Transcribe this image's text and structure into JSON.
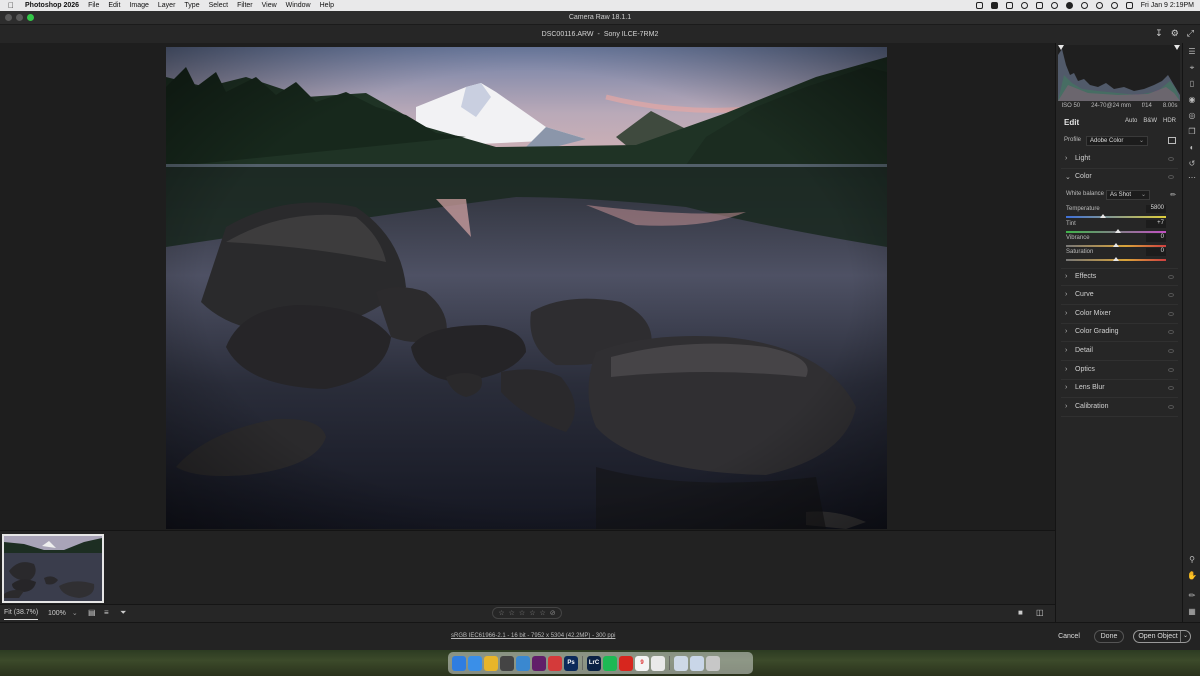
{
  "menubar": {
    "app_name": "Photoshop 2026",
    "items": [
      "File",
      "Edit",
      "Image",
      "Layer",
      "Type",
      "Select",
      "Filter",
      "View",
      "Window",
      "Help"
    ],
    "clock": "Fri Jan 9  2:19PM"
  },
  "window": {
    "title": "Camera Raw 18.1.1"
  },
  "document": {
    "filename": "DSC00116.ARW",
    "separator": "-",
    "camera": "Sony ILCE-7RM2"
  },
  "histogram_info": {
    "iso": "ISO 50",
    "lens": "24-70@24 mm",
    "aperture": "f/14",
    "shutter": "8.00s"
  },
  "edit_panel": {
    "heading": "Edit",
    "modes": [
      "Auto",
      "B&W",
      "HDR"
    ],
    "profile_label": "Profile",
    "profile_value": "Adobe Color",
    "sections": {
      "light": "Light",
      "color": "Color",
      "effects": "Effects",
      "curve": "Curve",
      "color_mixer": "Color Mixer",
      "color_grading": "Color Grading",
      "detail": "Detail",
      "optics": "Optics",
      "lens_blur": "Lens Blur",
      "calibration": "Calibration"
    },
    "white_balance_label": "White balance",
    "white_balance_value": "As Shot",
    "sliders": {
      "temperature": {
        "label": "Temperature",
        "value": "5800",
        "position": 0.37
      },
      "tint": {
        "label": "Tint",
        "value": "+7",
        "position": 0.52
      },
      "vibrance": {
        "label": "Vibrance",
        "value": "0",
        "position": 0.5
      },
      "saturation": {
        "label": "Saturation",
        "value": "0",
        "position": 0.5
      }
    }
  },
  "zoom": {
    "fit": "Fit (38.7%)",
    "percent": "100%"
  },
  "rating_stars": [
    "☆",
    "☆",
    "☆",
    "☆",
    "☆"
  ],
  "color_info": "sRGB IEC61966-2.1 - 16 bit - 7952 x 5304 (42.2MP) - 300 ppi",
  "buttons": {
    "cancel": "Cancel",
    "done": "Done",
    "open": "Open Object"
  },
  "colors": {
    "accent_slider_temp_left": "#3d6fd8",
    "accent_slider_temp_right": "#e0cf3a",
    "tint_left": "#3fb34a",
    "tint_right": "#c34fc3"
  },
  "dock_apps": [
    {
      "name": "finder-icon",
      "label": "",
      "color": "#2f7de1"
    },
    {
      "name": "mail-icon",
      "label": "",
      "color": "#3a8fe8"
    },
    {
      "name": "chrome-icon",
      "label": "",
      "color": "#e8b52a"
    },
    {
      "name": "app-icon",
      "label": "",
      "color": "#444"
    },
    {
      "name": "app-icon-2",
      "label": "",
      "color": "#3a88d0"
    },
    {
      "name": "slack-icon",
      "label": "",
      "color": "#611f69"
    },
    {
      "name": "app-icon-3",
      "label": "",
      "color": "#d43a3a"
    },
    {
      "name": "photoshop-icon",
      "label": "Ps",
      "color": "#0b2a5a"
    },
    {
      "name": "lightroom-classic-icon",
      "label": "LrC",
      "color": "#0a2244"
    },
    {
      "name": "spotify-icon",
      "label": "",
      "color": "#1db954"
    },
    {
      "name": "acrobat-icon",
      "label": "",
      "color": "#d7261e"
    },
    {
      "name": "calendar-icon",
      "label": "9",
      "color": "#f4f4f4"
    },
    {
      "name": "notes-icon",
      "label": "",
      "color": "#e9e9e9"
    },
    {
      "name": "finder-window-icon",
      "label": "",
      "color": "#cdd8e6"
    },
    {
      "name": "downloads-icon",
      "label": "",
      "color": "#c9d6e8"
    },
    {
      "name": "trash-icon",
      "label": "",
      "color": "#c7c7c7"
    }
  ]
}
